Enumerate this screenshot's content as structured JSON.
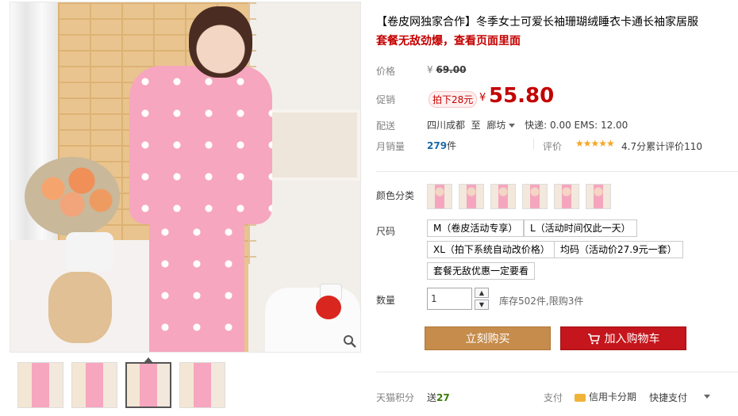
{
  "product": {
    "title": "【卷皮网独家合作】冬季女士可爱长袖珊瑚绒睡衣卡通长袖家居服",
    "subtitle": "套餐无敌劲爆，查看页面里面"
  },
  "price": {
    "label": "价格",
    "currency": "¥",
    "original": "69.00"
  },
  "promo": {
    "label": "促销",
    "tag": "拍下28元",
    "currency": "¥",
    "price": "55.80"
  },
  "shipping": {
    "label": "配送",
    "from": "四川成都",
    "to_word": "至",
    "to": "廊坊",
    "fee": "快递: 0.00 EMS: 12.00"
  },
  "sales": {
    "label": "月销量",
    "count": "279",
    "unit": "件",
    "rating_label": "评价",
    "stars": "★★★★★",
    "score_text": "4.7分累计评价",
    "review_count": "110"
  },
  "color": {
    "label": "颜色分类",
    "swatch_count": 6
  },
  "size": {
    "label": "尺码",
    "options": [
      "M（卷皮活动专享）",
      "L（活动时间仅此一天）",
      "XL（拍下系统自动改价格）",
      "均码（活动价27.9元一套）",
      "套餐无敌优惠一定要看"
    ]
  },
  "quantity": {
    "label": "数量",
    "value": "1",
    "up": "▲",
    "down": "▼",
    "stock": "库存502件,限购3件"
  },
  "buttons": {
    "buy": "立刻购买",
    "cart": "加入购物车"
  },
  "points": {
    "label": "天猫积分",
    "prefix": "送",
    "value": "27"
  },
  "payment": {
    "label": "支付",
    "credit": "信用卡分期",
    "quick": "快捷支付"
  },
  "colors": {
    "price_red": "#c40000",
    "buy_button": "#c68c4c",
    "cart_button": "#c4161c"
  }
}
